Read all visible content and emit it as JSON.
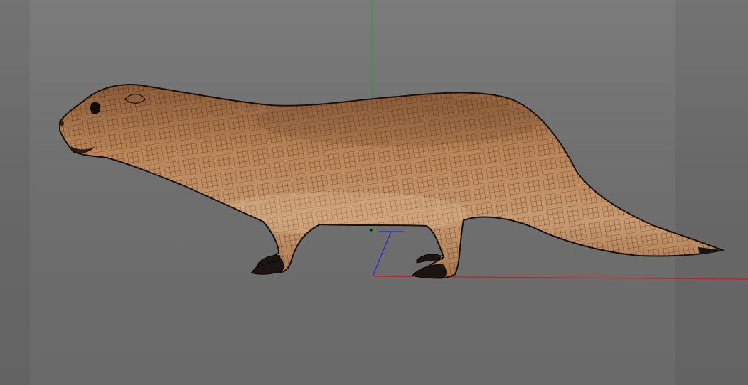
{
  "viewport": {
    "object": "otter-mesh",
    "display_mode": "textured-wireframe",
    "axis_colors": {
      "x": "#d21a1a",
      "y": "#1aa01a",
      "z": "#2a2ad0"
    },
    "background_color": "#6f6f6f",
    "mesh_color": "#b07a52",
    "wire_color": "#1e140c"
  }
}
